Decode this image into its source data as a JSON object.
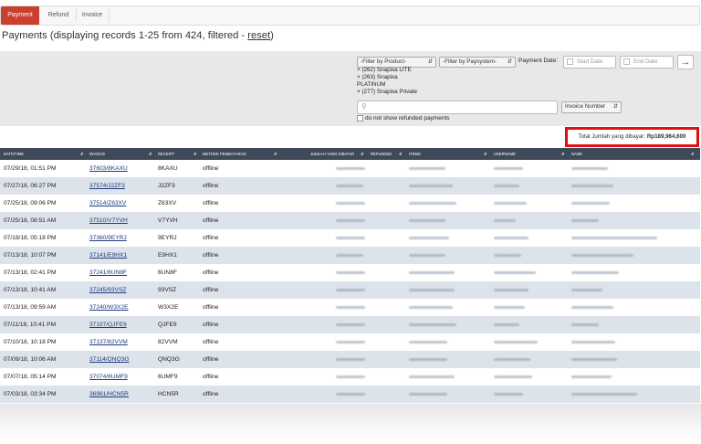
{
  "tabs": [
    {
      "label": "Payment",
      "active": true
    },
    {
      "label": "Refund",
      "active": false
    },
    {
      "label": "Invoice",
      "active": false
    }
  ],
  "page": {
    "title_prefix": "Payments (displaying records 1-25 from 424, filtered - ",
    "reset_link": "reset",
    "title_suffix": ")"
  },
  "filters": {
    "product_select": "-Filter by Product-",
    "paysystem_select": "-Filter by Paysystem-",
    "payment_date_label": "Payment Date:",
    "start_date_placeholder": "Start Date",
    "end_date_placeholder": "End Date",
    "selected_products": [
      "(262) Snapixa LITE",
      "(263) Snapixa",
      "PLATINUM",
      "(277) Snapixa Private"
    ],
    "search_field_select": "Invoice Number",
    "refunded_checkbox_label": "do not show refunded payments"
  },
  "total": {
    "label": "Total Jumlah yang dibayar:",
    "value": "Rp189,964,600"
  },
  "table": {
    "columns": [
      "DATE/TIME",
      "INVOICE",
      "RECEIPT",
      "METODE PEMBAYARAN",
      "JUMLAH YANG DIBAYAR",
      "REFUNDED",
      "ITEMS",
      "USERNAME",
      "NAME"
    ],
    "rows": [
      {
        "date": "07/29/18, 01:51 PM",
        "invoice": "37603/8KAXU",
        "receipt": "8KAXU",
        "method": "offline"
      },
      {
        "date": "07/27/18, 06:27 PM",
        "invoice": "37574/J2ZF3",
        "receipt": "J2ZF3",
        "method": "offline"
      },
      {
        "date": "07/25/18, 09:06 PM",
        "invoice": "37514/Z63XV",
        "receipt": "Z63XV",
        "method": "offline"
      },
      {
        "date": "07/25/18, 08:51 AM",
        "invoice": "37510/V7YVH",
        "receipt": "V7YVH",
        "method": "offline"
      },
      {
        "date": "07/18/18, 05:18 PM",
        "invoice": "37360/9EYRJ",
        "receipt": "9EYRJ",
        "method": "offline"
      },
      {
        "date": "07/13/18, 10:07 PM",
        "invoice": "37141/E9HX1",
        "receipt": "E9HX1",
        "method": "offline"
      },
      {
        "date": "07/13/18, 02:41 PM",
        "invoice": "37241/6UN8F",
        "receipt": "6UN8F",
        "method": "offline"
      },
      {
        "date": "07/13/18, 10:41 AM",
        "invoice": "37245/93VSZ",
        "receipt": "93VSZ",
        "method": "offline"
      },
      {
        "date": "07/13/18, 09:59 AM",
        "invoice": "37240/W3X2E",
        "receipt": "W3X2E",
        "method": "offline"
      },
      {
        "date": "07/11/18, 10:41 PM",
        "invoice": "37197/QJFE9",
        "receipt": "QJFE9",
        "method": "offline"
      },
      {
        "date": "07/10/18, 10:18 PM",
        "invoice": "37137/82VVM",
        "receipt": "82VVM",
        "method": "offline"
      },
      {
        "date": "07/09/18, 10:06 AM",
        "invoice": "37114/QNQ3G",
        "receipt": "QNQ3G",
        "method": "offline"
      },
      {
        "date": "07/07/18, 05:14 PM",
        "invoice": "37074/6UMF9",
        "receipt": "6UMF9",
        "method": "offline"
      },
      {
        "date": "07/03/18, 03:34 PM",
        "invoice": "36961/HCN5R",
        "receipt": "HCN5R",
        "method": "offline"
      }
    ]
  },
  "colors": {
    "accent": "#c9402f",
    "header_bg": "#3e4a5a",
    "row_alt": "#dde3ea",
    "highlight_border": "#e01010",
    "link": "#1c3c80"
  }
}
